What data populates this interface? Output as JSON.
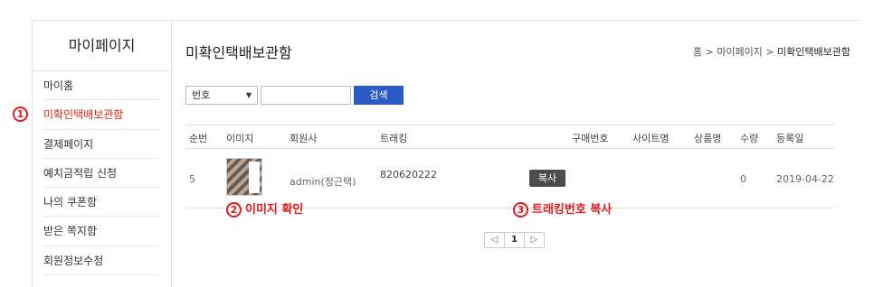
{
  "sidebar": {
    "title": "마이페이지",
    "items": [
      {
        "label": "마이홈"
      },
      {
        "label": "미확인택배보관함"
      },
      {
        "label": "결제페이지"
      },
      {
        "label": "예치금적립 신청"
      },
      {
        "label": "나의 쿠폰함"
      },
      {
        "label": "받은 쪽지함"
      },
      {
        "label": "회원정보수정"
      }
    ]
  },
  "main": {
    "title": "미확인택배보관함",
    "breadcrumb": {
      "home": "홈",
      "sep": ">",
      "parent": "마이페이지",
      "current": "미확인택배보관함"
    }
  },
  "search": {
    "select_value": "번호",
    "input_value": "",
    "button_label": "검색"
  },
  "table": {
    "headers": [
      "순번",
      "이미지",
      "회원사",
      "트래킹",
      "구매번호",
      "사이트명",
      "상품명",
      "수량",
      "등록일"
    ],
    "rows": [
      {
        "index": "5",
        "member": "admin(정근택)",
        "tracking": "820620222",
        "purchase_no": "",
        "site": "",
        "product": "",
        "quantity": "0",
        "date": "2019-04-22",
        "copy_label": "복사"
      }
    ]
  },
  "pagination": {
    "prev": "◁",
    "current": "1",
    "next": "▷"
  },
  "annotations": [
    {
      "num": "1"
    },
    {
      "num": "2",
      "text": "이미지 확인"
    },
    {
      "num": "3",
      "text": "트래킹번호 복사"
    }
  ],
  "colors": {
    "accent_red": "#d9251c",
    "search_button": "#2a5bc7",
    "copy_button": "#4d4d4d"
  }
}
